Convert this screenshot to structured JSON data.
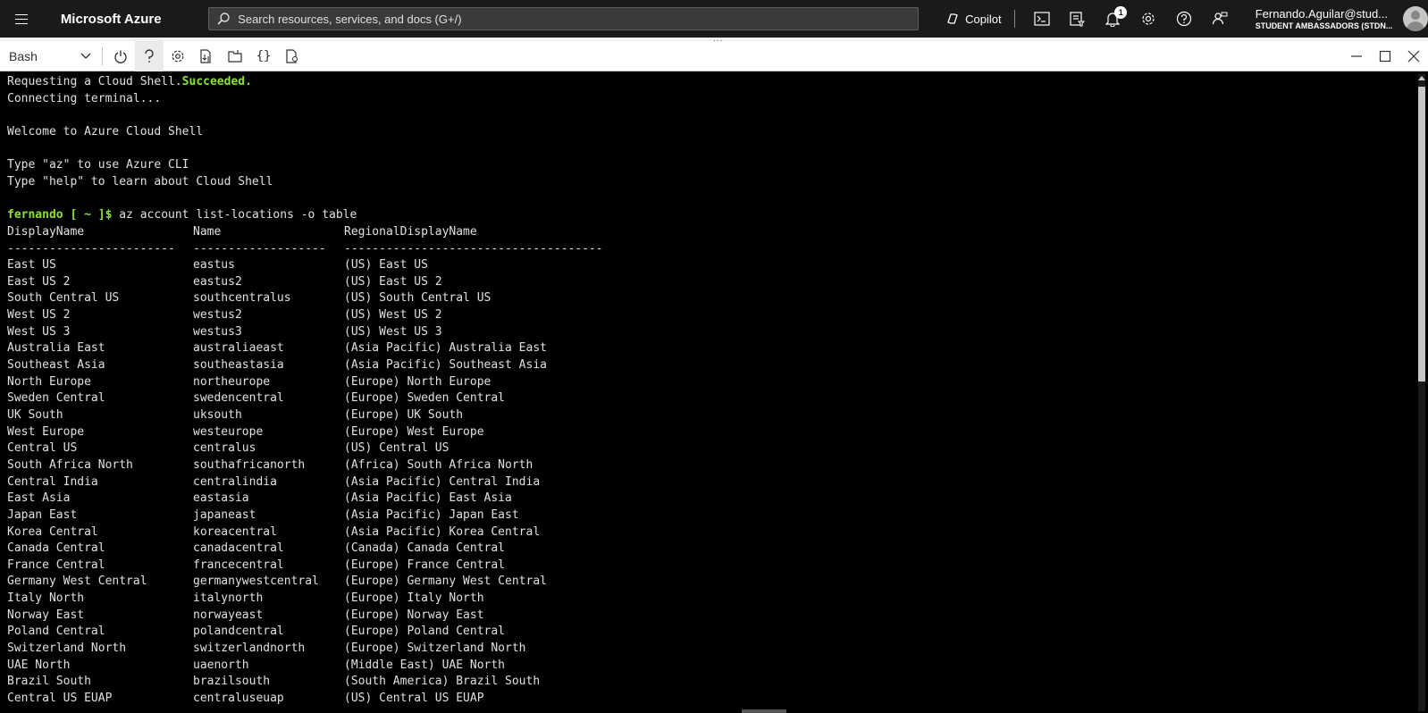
{
  "topbar": {
    "brand": "Microsoft Azure",
    "search_placeholder": "Search resources, services, and docs (G+/)",
    "copilot_label": "Copilot",
    "notification_count": "1",
    "account_name": "Fernando.Aguilar@stud...",
    "account_directory": "STUDENT AMBASSADORS (STDN..."
  },
  "shell": {
    "shell_type": "Bash",
    "toolbar_icons": [
      "power-icon",
      "help-icon",
      "settings-icon",
      "upload-download-icon",
      "new-session-icon",
      "editor-braces-icon",
      "web-preview-icon"
    ],
    "window_icons": [
      "minimize-icon",
      "maximize-icon",
      "close-icon"
    ]
  },
  "terminal": {
    "intro": [
      {
        "text": "Requesting a Cloud Shell.",
        "highlight": "Succeeded."
      },
      {
        "text": "Connecting terminal..."
      },
      {
        "text": ""
      },
      {
        "text": "Welcome to Azure Cloud Shell"
      },
      {
        "text": ""
      },
      {
        "text": "Type \"az\" to use Azure CLI"
      },
      {
        "text": "Type \"help\" to learn about Cloud Shell"
      },
      {
        "text": ""
      }
    ],
    "prompt": "fernando [ ~ ]$",
    "command": " az account list-locations -o table",
    "headers": [
      "DisplayName",
      "Name",
      "RegionalDisplayName"
    ],
    "dashes": [
      "------------------------",
      "-------------------",
      "-------------------------------------"
    ],
    "rows": [
      [
        "East US",
        "eastus",
        "(US) East US"
      ],
      [
        "East US 2",
        "eastus2",
        "(US) East US 2"
      ],
      [
        "South Central US",
        "southcentralus",
        "(US) South Central US"
      ],
      [
        "West US 2",
        "westus2",
        "(US) West US 2"
      ],
      [
        "West US 3",
        "westus3",
        "(US) West US 3"
      ],
      [
        "Australia East",
        "australiaeast",
        "(Asia Pacific) Australia East"
      ],
      [
        "Southeast Asia",
        "southeastasia",
        "(Asia Pacific) Southeast Asia"
      ],
      [
        "North Europe",
        "northeurope",
        "(Europe) North Europe"
      ],
      [
        "Sweden Central",
        "swedencentral",
        "(Europe) Sweden Central"
      ],
      [
        "UK South",
        "uksouth",
        "(Europe) UK South"
      ],
      [
        "West Europe",
        "westeurope",
        "(Europe) West Europe"
      ],
      [
        "Central US",
        "centralus",
        "(US) Central US"
      ],
      [
        "South Africa North",
        "southafricanorth",
        "(Africa) South Africa North"
      ],
      [
        "Central India",
        "centralindia",
        "(Asia Pacific) Central India"
      ],
      [
        "East Asia",
        "eastasia",
        "(Asia Pacific) East Asia"
      ],
      [
        "Japan East",
        "japaneast",
        "(Asia Pacific) Japan East"
      ],
      [
        "Korea Central",
        "koreacentral",
        "(Asia Pacific) Korea Central"
      ],
      [
        "Canada Central",
        "canadacentral",
        "(Canada) Canada Central"
      ],
      [
        "France Central",
        "francecentral",
        "(Europe) France Central"
      ],
      [
        "Germany West Central",
        "germanywestcentral",
        "(Europe) Germany West Central"
      ],
      [
        "Italy North",
        "italynorth",
        "(Europe) Italy North"
      ],
      [
        "Norway East",
        "norwayeast",
        "(Europe) Norway East"
      ],
      [
        "Poland Central",
        "polandcentral",
        "(Europe) Poland Central"
      ],
      [
        "Switzerland North",
        "switzerlandnorth",
        "(Europe) Switzerland North"
      ],
      [
        "UAE North",
        "uaenorth",
        "(Middle East) UAE North"
      ],
      [
        "Brazil South",
        "brazilsouth",
        "(South America) Brazil South"
      ],
      [
        "Central US EUAP",
        "centraluseuap",
        "(US) Central US EUAP"
      ]
    ]
  },
  "colors": {
    "topbar_bg": "#1b1a19",
    "prompt_green": "#8ae234",
    "terminal_bg": "#000000"
  }
}
